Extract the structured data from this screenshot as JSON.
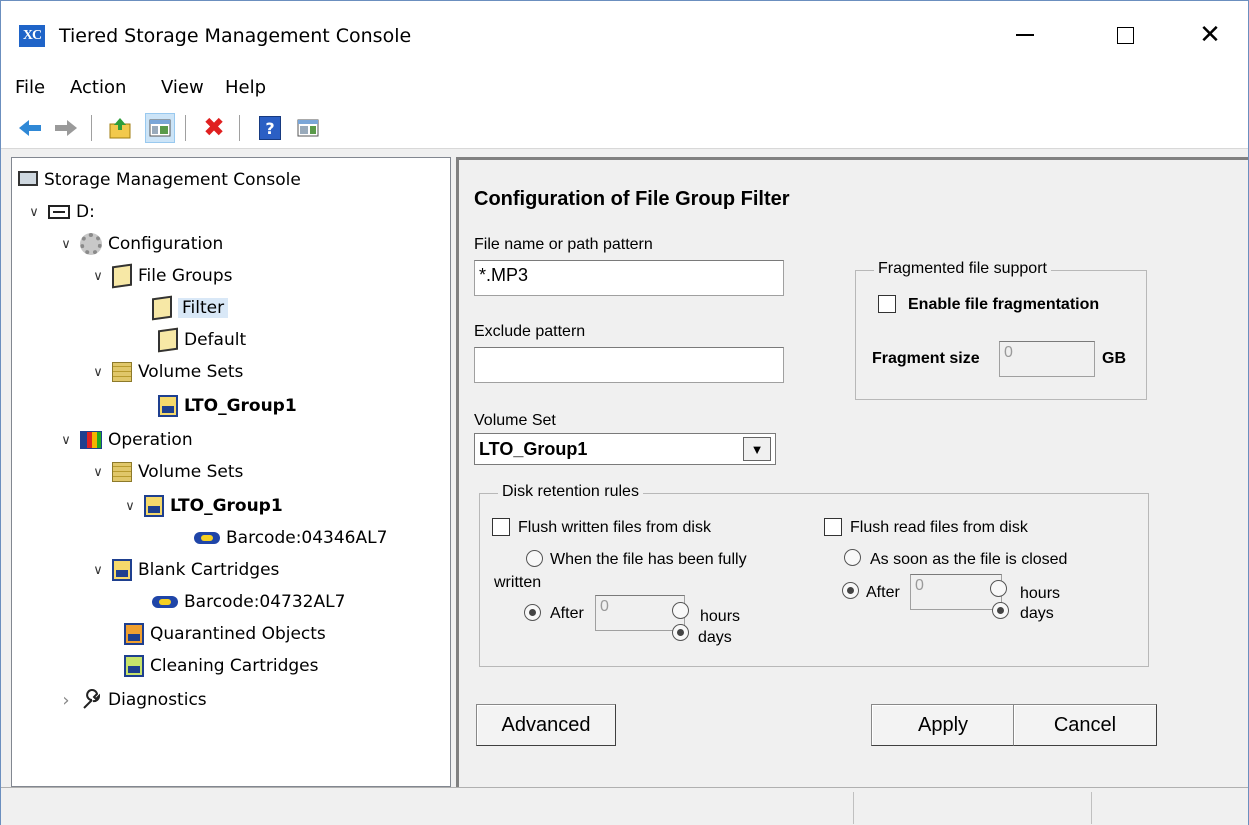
{
  "window": {
    "app_icon_text": "XC",
    "title": "Tiered Storage Management Console",
    "minimize_icon": "minimize-icon",
    "maximize_icon": "maximize-icon",
    "close_glyph": "✕"
  },
  "menu": {
    "items": [
      "File",
      "Action",
      "View",
      "Help"
    ]
  },
  "toolbar": {
    "icons": [
      "back-arrow-icon",
      "forward-arrow-icon",
      "up-folder-icon",
      "show-hide-tree-icon",
      "delete-icon",
      "help-icon",
      "action-pane-icon"
    ],
    "delete_glyph": "✖",
    "help_glyph": "?"
  },
  "tree": {
    "root": "Storage Management Console",
    "drive": "D:",
    "configuration": "Configuration",
    "file_groups": "File Groups",
    "filter": "Filter",
    "default": "Default",
    "volume_sets_config": "Volume Sets",
    "lto_group1_config": "LTO_Group1",
    "operation": "Operation",
    "volume_sets_op": "Volume Sets",
    "lto_group1_op": "LTO_Group1",
    "barcode_1": "Barcode:04346AL7",
    "blank_cartridges": "Blank Cartridges",
    "barcode_2": "Barcode:04732AL7",
    "quarantined": "Quarantined Objects",
    "cleaning": "Cleaning Cartridges",
    "diagnostics": "Diagnostics",
    "expanded_glyph": "∨",
    "collapsed_glyph": "›"
  },
  "form": {
    "heading": "Configuration of File Group Filter",
    "file_pattern_label": "File name or path pattern",
    "file_pattern_value": "*.MP3",
    "exclude_label": "Exclude pattern",
    "exclude_value": "",
    "volume_set_label": "Volume Set",
    "volume_set_value": "LTO_Group1",
    "dropdown_glyph": "▼",
    "fragment": {
      "legend": "Fragmented file support",
      "enable_label": "Enable file fragmentation",
      "enable_checked": false,
      "size_label": "Fragment size",
      "size_value": "0",
      "unit": "GB"
    },
    "retention": {
      "legend": "Disk retention rules",
      "flush_written_label": "Flush written files from disk",
      "flush_written_checked": false,
      "when_written_label_1": "When the file has been fully",
      "when_written_label_2": "written",
      "after_label": "After",
      "written_after_value": "0",
      "hours_label": "hours",
      "days_label": "days",
      "flush_read_label": "Flush read files from disk",
      "flush_read_checked": false,
      "as_soon_label": "As soon as the file is closed",
      "read_after_value": "0"
    },
    "advanced_button": "Advanced",
    "apply_button": "Apply",
    "cancel_button": "Cancel"
  }
}
